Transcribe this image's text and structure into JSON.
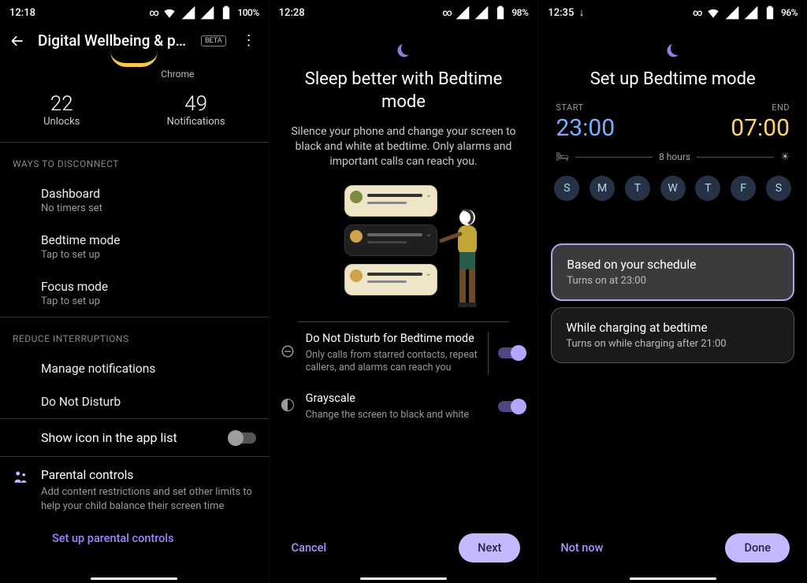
{
  "panel1": {
    "status": {
      "time": "12:18",
      "icons": "⚭ ◢ ◢ ▮ 100%"
    },
    "title": "Digital Wellbeing & pa...",
    "beta": "BETA",
    "chrome_label": "Chrome",
    "stats": {
      "unlocks": {
        "num": "22",
        "lbl": "Unlocks"
      },
      "notifs": {
        "num": "49",
        "lbl": "Notifications"
      }
    },
    "hdr_disconnect": "WAYS TO DISCONNECT",
    "dashboard": {
      "p": "Dashboard",
      "s": "No timers set"
    },
    "bedtime": {
      "p": "Bedtime mode",
      "s": "Tap to set up"
    },
    "focus": {
      "p": "Focus mode",
      "s": "Tap to set up"
    },
    "hdr_reduce": "REDUCE INTERRUPTIONS",
    "manage_notifs": "Manage notifications",
    "dnd": "Do Not Disturb",
    "show_icon": "Show icon in the app list",
    "parental": {
      "p": "Parental controls",
      "s": "Add content restrictions and set other limits to help your child balance their screen time",
      "link": "Set up parental controls"
    }
  },
  "panel2": {
    "status": {
      "time": "12:28",
      "icons": "⚭ ◢ ◢ ▮ 98%"
    },
    "title": "Sleep better with Bedtime mode",
    "desc": "Silence your phone and change your screen to black and white at bedtime. Only alarms and important calls can reach you.",
    "dnd": {
      "p": "Do Not Disturb for Bedtime mode",
      "s": "Only calls from starred contacts, repeat callers, and alarms can reach you"
    },
    "gray": {
      "p": "Grayscale",
      "s": "Change the screen to black and white"
    },
    "cancel": "Cancel",
    "next": "Next"
  },
  "panel3": {
    "status": {
      "time": "12:35",
      "icons": "⚭ ▾ ◢ ◢ ▮ 96%",
      "dl": "↓"
    },
    "title": "Set up Bedtime mode",
    "start_lbl": "START",
    "start_val": "23:00",
    "end_lbl": "END",
    "end_val": "07:00",
    "duration": "8 hours",
    "days": [
      "S",
      "M",
      "T",
      "W",
      "T",
      "F",
      "S"
    ],
    "card1": {
      "p": "Based on your schedule",
      "s": "Turns on at 23:00"
    },
    "card2": {
      "p": "While charging at bedtime",
      "s": "Turns on while charging after 21:00"
    },
    "notnow": "Not now",
    "done": "Done"
  }
}
